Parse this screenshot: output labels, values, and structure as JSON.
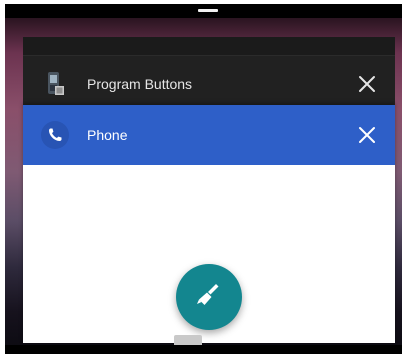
{
  "recents": {
    "cards": [
      {
        "id": "program-buttons",
        "title": "Program Buttons",
        "icon": "phone-device-icon",
        "close_icon": "close-icon"
      },
      {
        "id": "phone",
        "title": "Phone",
        "icon": "phone-handset-icon",
        "close_icon": "close-icon",
        "header_color": "#2e5fc8"
      }
    ],
    "clear_all_icon": "broom-icon",
    "clear_all_color": "#13868f"
  }
}
